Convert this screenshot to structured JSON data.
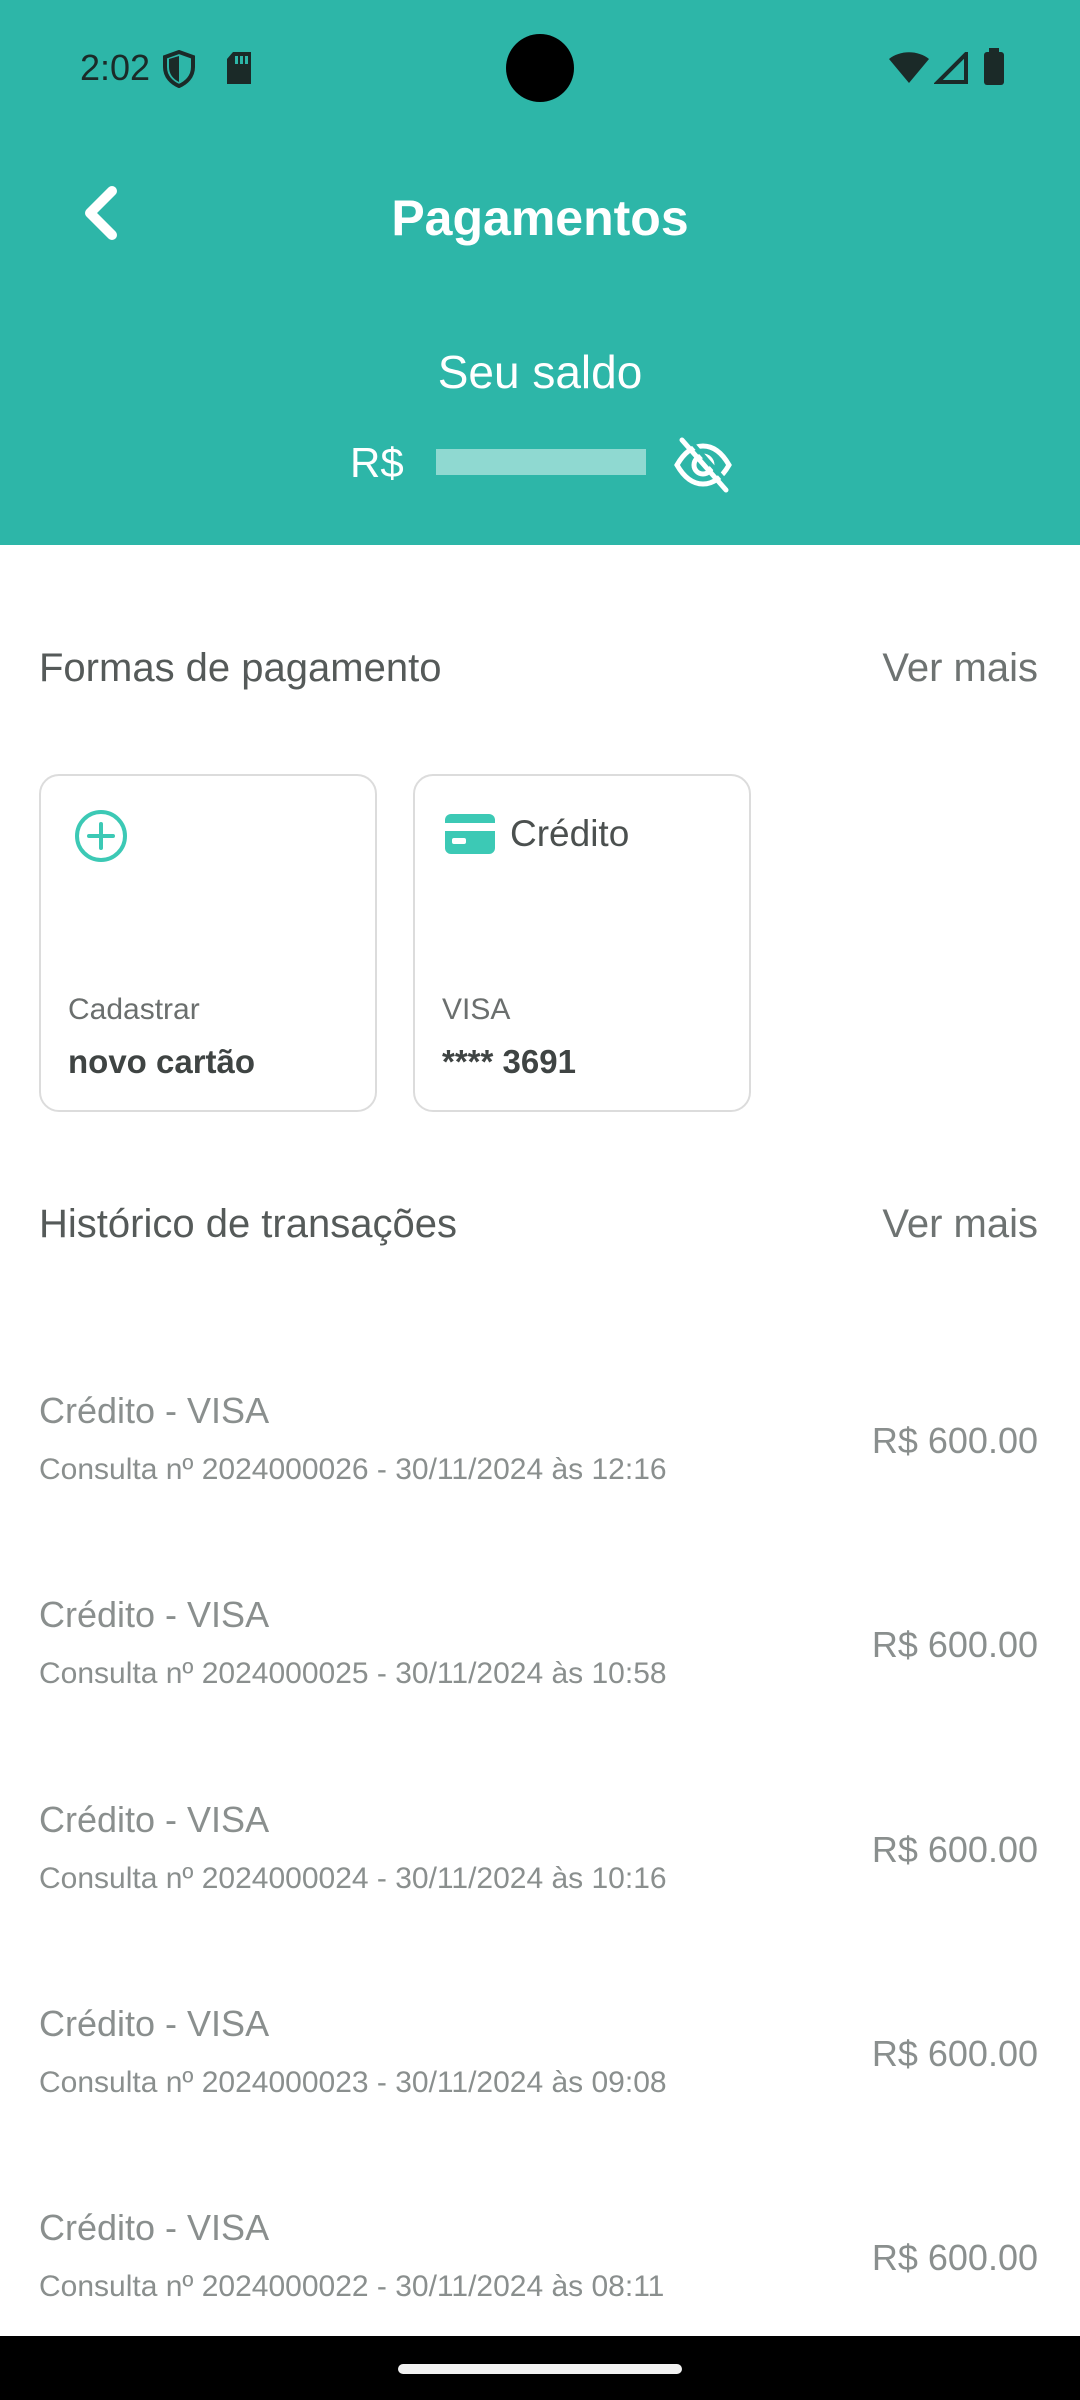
{
  "status_bar": {
    "time": "2:02"
  },
  "header": {
    "title": "Pagamentos",
    "balance_label": "Seu saldo",
    "balance_currency": "R$",
    "back_icon": "chevron-left-icon",
    "visibility_icon": "eye-off-icon"
  },
  "payment_methods": {
    "title": "Formas de pagamento",
    "see_more": "Ver mais",
    "add_card": {
      "sub": "Cadastrar",
      "main": "novo cartão",
      "icon": "plus-circle-icon"
    },
    "credit_card": {
      "type": "Crédito",
      "brand": "VISA",
      "number": "**** 3691",
      "icon": "credit-card-icon"
    }
  },
  "history": {
    "title": "Histórico de transações",
    "see_more": "Ver mais",
    "transactions": [
      {
        "title": "Crédito - VISA",
        "desc": "Consulta nº 2024000026 - 30/11/2024 às 12:16",
        "amount": "R$ 600.00"
      },
      {
        "title": "Crédito - VISA",
        "desc": "Consulta nº 2024000025 - 30/11/2024 às 10:58",
        "amount": "R$ 600.00"
      },
      {
        "title": "Crédito - VISA",
        "desc": "Consulta nº 2024000024 - 30/11/2024 às 10:16",
        "amount": "R$ 600.00"
      },
      {
        "title": "Crédito - VISA",
        "desc": "Consulta nº 2024000023 - 30/11/2024 às 09:08",
        "amount": "R$ 600.00"
      },
      {
        "title": "Crédito - VISA",
        "desc": "Consulta nº 2024000022 - 30/11/2024 às 08:11",
        "amount": "R$ 600.00"
      }
    ]
  },
  "colors": {
    "brand": "#2db6a8",
    "accent": "#3cc9b5"
  }
}
